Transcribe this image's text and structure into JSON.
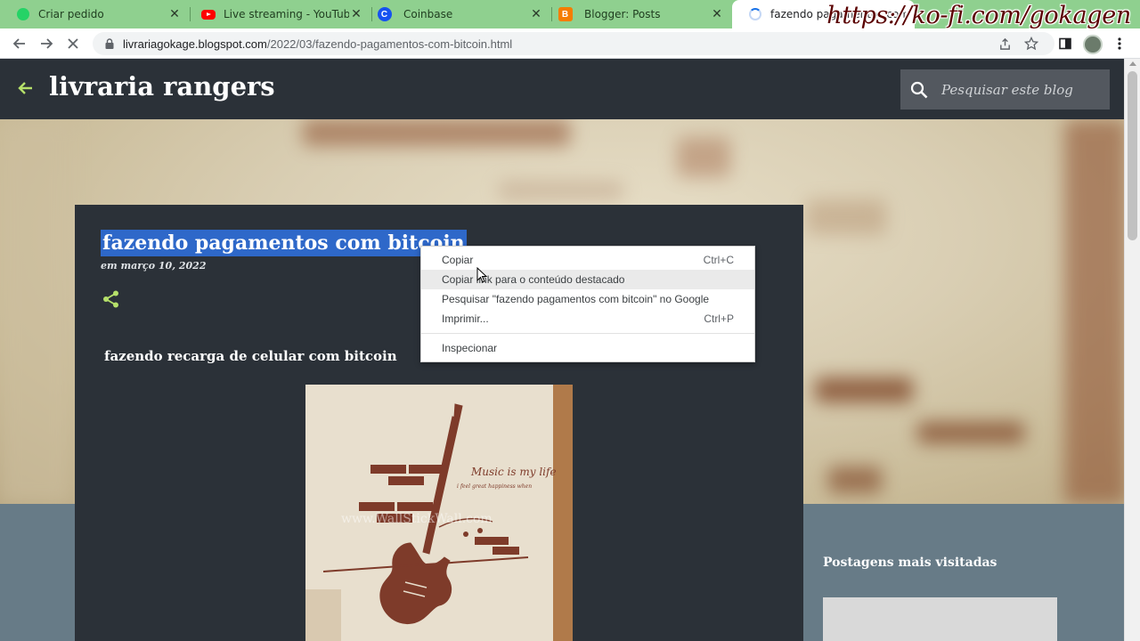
{
  "browser": {
    "tabs": [
      {
        "title": "Criar pedido",
        "icon": "whatsapp-icon",
        "active": false
      },
      {
        "title": "Live streaming - YouTube Studio",
        "icon": "youtube-icon",
        "active": false
      },
      {
        "title": "Coinbase",
        "icon": "coinbase-icon",
        "active": false
      },
      {
        "title": "Blogger: Posts",
        "icon": "blogger-icon",
        "active": false
      },
      {
        "title": "fazendo pagamentos com bitcoin",
        "icon": "loading-icon",
        "active": true
      }
    ],
    "close_glyph": "✕",
    "coinbase_glyph": "C",
    "blogger_glyph": "B",
    "url_host": "livrariagokage.blogspot.com",
    "url_path": "/2022/03/fazendo-pagamentos-com-bitcoin.html",
    "watermark": "https://ko-fi.com/gokagen"
  },
  "blog": {
    "title": "livraria rangers",
    "search_placeholder": "Pesquisar este blog"
  },
  "post": {
    "title": "fazendo pagamentos com bitcoin",
    "date": "em março 10, 2022",
    "subtitle": "fazendo recarga de celular com bitcoin",
    "image_text": "Music is my life",
    "image_caption": "i feel great happiness when",
    "image_watermark": "www.WallStickWall.com"
  },
  "sidebar": {
    "heading": "Postagens mais visitadas"
  },
  "context_menu": {
    "items": [
      {
        "label": "Copiar",
        "shortcut": "Ctrl+C"
      },
      {
        "label": "Copiar link para o conteúdo destacado",
        "shortcut": ""
      },
      {
        "label": "Pesquisar \"fazendo pagamentos com bitcoin\" no Google",
        "shortcut": ""
      },
      {
        "label": "Imprimir...",
        "shortcut": "Ctrl+P"
      },
      {
        "label": "Inspecionar",
        "shortcut": ""
      }
    ],
    "hovered_index": 1
  },
  "colors": {
    "tab_strip": "#8fd08f",
    "blog_header": "#2b3138",
    "accent_green": "#b5e06a",
    "selection": "#2e68c9"
  }
}
